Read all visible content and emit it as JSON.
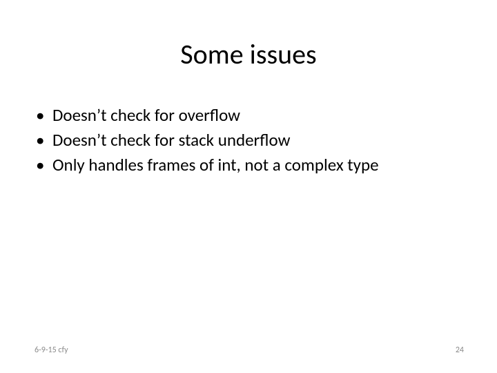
{
  "title": "Some issues",
  "bullets": [
    "Doesn’t check for overflow",
    "Doesn’t check for stack underflow",
    "Only handles frames of int, not a complex type"
  ],
  "footer": {
    "left": "6-9-15 cfy",
    "right": "24"
  }
}
